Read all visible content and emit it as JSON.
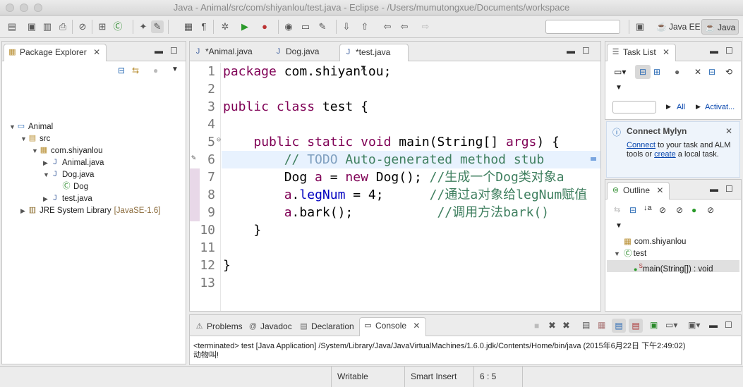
{
  "window": {
    "title": "Java - Animal/src/com/shiyanlou/test.java - Eclipse - /Users/mumutongxue/Documents/workspace"
  },
  "perspectives": {
    "java_ee": "Java EE",
    "java": "Java"
  },
  "package_explorer": {
    "tab_label": "Package Explorer",
    "tree": [
      {
        "label": "Animal",
        "icon": "project-icon",
        "level": 0,
        "expanded": true
      },
      {
        "label": "src",
        "icon": "source-folder-icon",
        "level": 1,
        "expanded": true
      },
      {
        "label": "com.shiyanlou",
        "icon": "package-icon",
        "level": 2,
        "expanded": true
      },
      {
        "label": "Animal.java",
        "icon": "java-file-icon",
        "level": 3,
        "expanded": false
      },
      {
        "label": "Dog.java",
        "icon": "java-file-icon",
        "level": 3,
        "expanded": true
      },
      {
        "label": "Dog",
        "icon": "class-icon",
        "level": 4
      },
      {
        "label": "test.java",
        "icon": "java-file-icon",
        "level": 3,
        "expanded": false
      },
      {
        "label": "JRE System Library",
        "suffix": "[JavaSE-1.6]",
        "icon": "library-icon",
        "level": 1,
        "expanded": false
      }
    ]
  },
  "editor": {
    "tabs": [
      {
        "label": "*Animal.java",
        "active": false
      },
      {
        "label": "Dog.java",
        "active": false
      },
      {
        "label": "*test.java",
        "active": true
      }
    ],
    "lines": [
      {
        "num": "1",
        "tokens": [
          {
            "t": "package",
            "c": "kw"
          },
          {
            "t": " com.shiyanlou;",
            "c": ""
          }
        ]
      },
      {
        "num": "2",
        "tokens": []
      },
      {
        "num": "3",
        "tokens": [
          {
            "t": "public",
            "c": "kw"
          },
          {
            "t": " ",
            "c": ""
          },
          {
            "t": "class",
            "c": "kw"
          },
          {
            "t": " test {",
            "c": ""
          }
        ]
      },
      {
        "num": "4",
        "tokens": []
      },
      {
        "num": "5",
        "tokens": [
          {
            "t": "    ",
            "c": ""
          },
          {
            "t": "public",
            "c": "kw"
          },
          {
            "t": " ",
            "c": ""
          },
          {
            "t": "static",
            "c": "kw"
          },
          {
            "t": " ",
            "c": ""
          },
          {
            "t": "void",
            "c": "kw"
          },
          {
            "t": " main(String[] ",
            "c": ""
          },
          {
            "t": "args",
            "c": "kw"
          },
          {
            "t": ") {",
            "c": ""
          }
        ]
      },
      {
        "num": "6",
        "tokens": [
          {
            "t": "        // ",
            "c": "cm"
          },
          {
            "t": "TODO",
            "c": "todo"
          },
          {
            "t": " Auto-generated method stub",
            "c": "cm"
          }
        ]
      },
      {
        "num": "7",
        "tokens": [
          {
            "t": "        Dog ",
            "c": ""
          },
          {
            "t": "a",
            "c": "kw"
          },
          {
            "t": " = ",
            "c": ""
          },
          {
            "t": "new",
            "c": "kw"
          },
          {
            "t": " Dog(); ",
            "c": ""
          },
          {
            "t": "//生成一个Dog类对象a",
            "c": "cm"
          }
        ]
      },
      {
        "num": "8",
        "tokens": [
          {
            "t": "        ",
            "c": ""
          },
          {
            "t": "a",
            "c": "kw"
          },
          {
            "t": ".",
            "c": ""
          },
          {
            "t": "legNum",
            "c": "fld"
          },
          {
            "t": " = 4;      ",
            "c": ""
          },
          {
            "t": "//通过a对象给legNum赋值",
            "c": "cm"
          }
        ]
      },
      {
        "num": "9",
        "tokens": [
          {
            "t": "        ",
            "c": ""
          },
          {
            "t": "a",
            "c": "kw"
          },
          {
            "t": ".bark();           ",
            "c": ""
          },
          {
            "t": "//调用方法bark()",
            "c": "cm"
          }
        ]
      },
      {
        "num": "10",
        "tokens": [
          {
            "t": "    }",
            "c": ""
          }
        ]
      },
      {
        "num": "11",
        "tokens": []
      },
      {
        "num": "12",
        "tokens": [
          {
            "t": "}",
            "c": ""
          }
        ]
      },
      {
        "num": "13",
        "tokens": []
      }
    ]
  },
  "task_list": {
    "tab_label": "Task List",
    "filter_all": "All",
    "filter_activate": "Activat..."
  },
  "mylyn": {
    "title": "Connect Mylyn",
    "link_connect": "Connect",
    "text_1": " to your task and ALM tools or ",
    "link_create": "create",
    "text_2": " a local task."
  },
  "outline": {
    "tab_label": "Outline",
    "items": [
      {
        "label": "com.shiyanlou",
        "icon": "package-icon"
      },
      {
        "label": "test",
        "icon": "class-icon"
      },
      {
        "label": "main(String[]) : void",
        "icon": "method-icon"
      }
    ]
  },
  "bottom_panel": {
    "tabs": [
      "Problems",
      "Javadoc",
      "Declaration",
      "Console"
    ],
    "active_tab": "Console",
    "console_header": "<terminated> test [Java Application] /System/Library/Java/JavaVirtualMachines/1.6.0.jdk/Contents/Home/bin/java (2015年6月22日 下午2:49:02)",
    "console_output": "动物叫!"
  },
  "status": {
    "writable": "Writable",
    "insert_mode": "Smart Insert",
    "position": "6 : 5"
  },
  "colors": {
    "keyword": "#7f0055",
    "comment": "#3f7f5f",
    "field": "#0000c0",
    "current_line": "#e8f2fe",
    "link": "#0645ad"
  }
}
